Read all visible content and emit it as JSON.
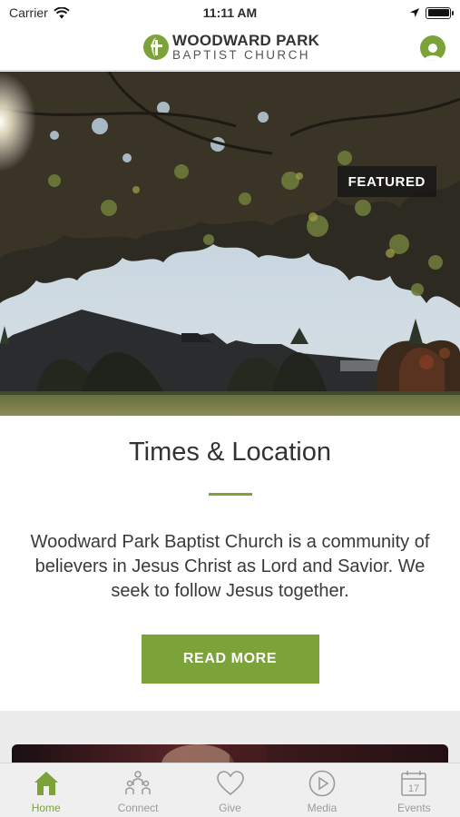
{
  "status_bar": {
    "carrier": "Carrier",
    "time": "11:11 AM"
  },
  "header": {
    "logo_line1": "WOODWARD PARK",
    "logo_line2": "BAPTIST CHURCH"
  },
  "hero": {
    "badge": "FEATURED"
  },
  "card": {
    "title": "Times & Location",
    "body": "Woodward Park Baptist Church is a community of believers in Jesus Christ as Lord and Savior. We seek to follow Jesus together.",
    "button": "READ MORE"
  },
  "tabs": [
    {
      "label": "Home",
      "icon": "home-icon",
      "active": true
    },
    {
      "label": "Connect",
      "icon": "people-icon",
      "active": false
    },
    {
      "label": "Give",
      "icon": "heart-icon",
      "active": false
    },
    {
      "label": "Media",
      "icon": "play-icon",
      "active": false
    },
    {
      "label": "Events",
      "icon": "calendar-icon",
      "active": false
    }
  ],
  "calendar_day": "17",
  "colors": {
    "accent": "#7ca23a",
    "tab_inactive": "#9a9a9a"
  }
}
